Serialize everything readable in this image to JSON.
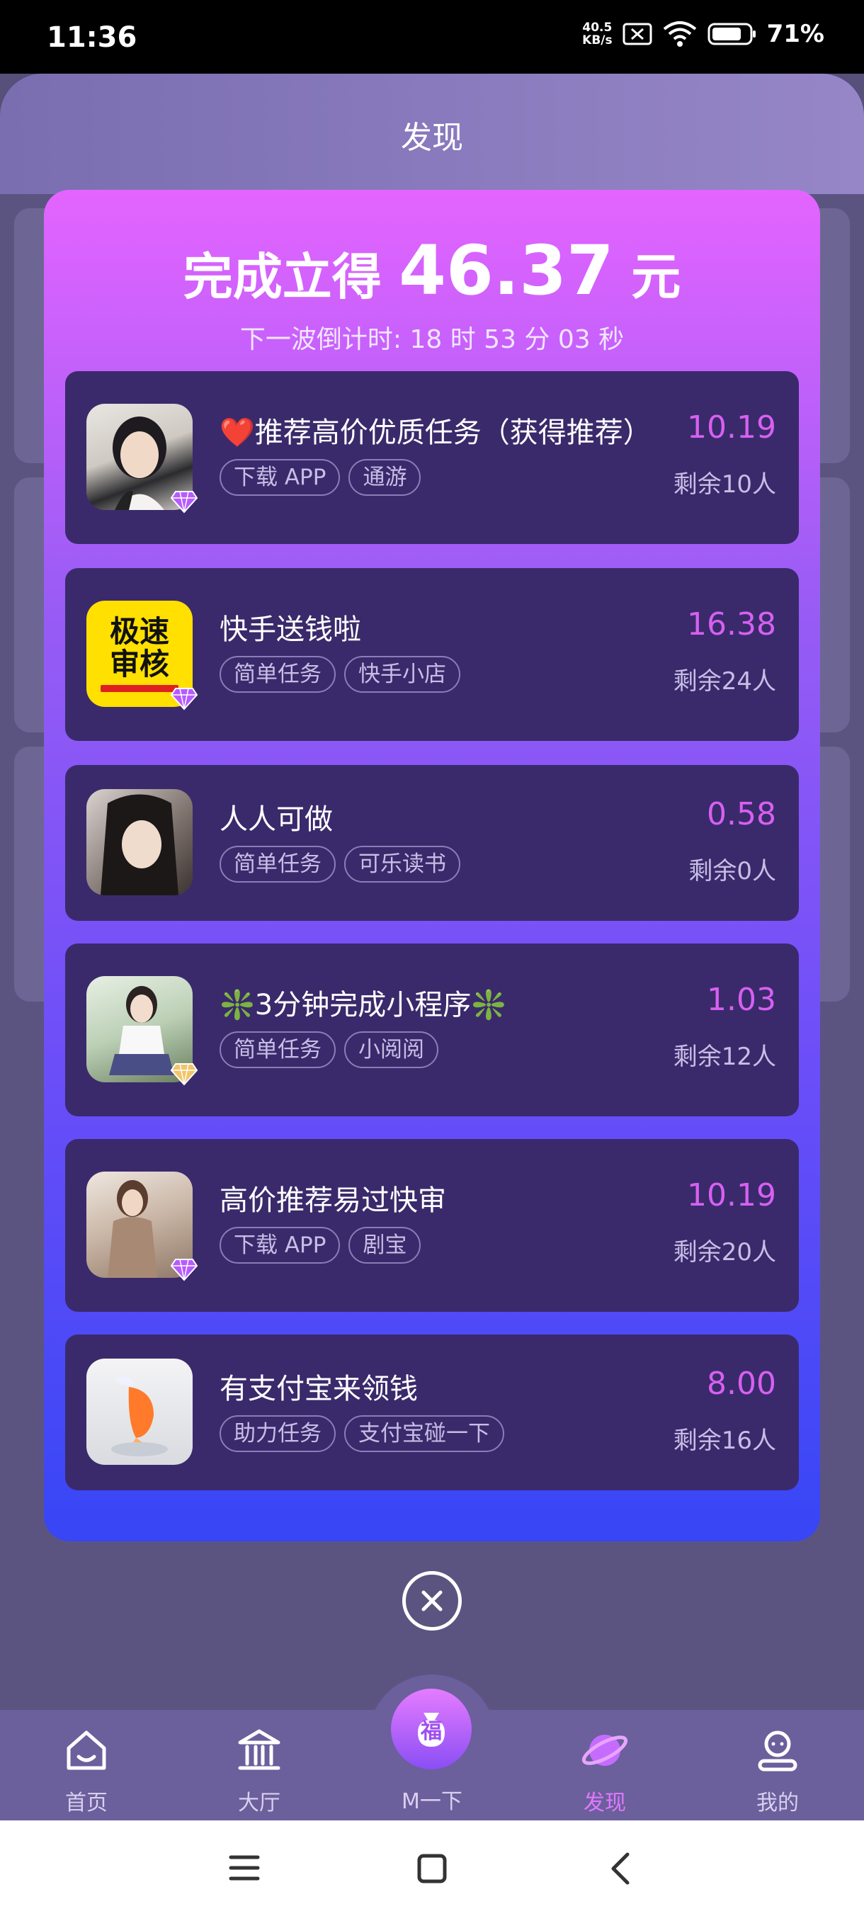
{
  "status_bar": {
    "time": "11:36",
    "net_speed_top": "40.5",
    "net_speed_bottom": "KB/s",
    "battery": "71%"
  },
  "header": {
    "title": "发现"
  },
  "popup": {
    "title_prefix": "完成立得",
    "title_amount": "46.37",
    "title_suffix": "元",
    "countdown": "下一波倒计时: 18 时 53 分 03 秒",
    "tasks": [
      {
        "name": "❤️推荐高价优质任务（获得推荐）",
        "tags": [
          "下载 APP",
          "通游"
        ],
        "price": "10.19",
        "remain": "剩余10人",
        "badge": "diamond-purple",
        "thumb": "girl-short-hair"
      },
      {
        "name": "快手送钱啦",
        "tags": [
          "简单任务",
          "快手小店"
        ],
        "price": "16.38",
        "remain": "剩余24人",
        "badge": "diamond-purple",
        "thumb": "yellow-logo",
        "thumb_text_1": "极速",
        "thumb_text_2": "审核"
      },
      {
        "name": "人人可做",
        "tags": [
          "简单任务",
          "可乐读书"
        ],
        "price": "0.58",
        "remain": "剩余0人",
        "badge": "",
        "thumb": "girl-long-hair"
      },
      {
        "name": "❇️3分钟完成小程序❇️",
        "tags": [
          "简单任务",
          "小阅阅"
        ],
        "price": "1.03",
        "remain": "剩余12人",
        "badge": "diamond-gold",
        "thumb": "girl-uniform"
      },
      {
        "name": "高价推荐易过快审",
        "tags": [
          "下载 APP",
          "剧宝"
        ],
        "price": "10.19",
        "remain": "剩余20人",
        "badge": "diamond-purple",
        "thumb": "woman-sweater"
      },
      {
        "name": "有支付宝来领钱",
        "tags": [
          "助力任务",
          "支付宝碰一下"
        ],
        "price": "8.00",
        "remain": "剩余16人",
        "badge": "",
        "thumb": "koi-fish"
      }
    ]
  },
  "nav": {
    "items": [
      {
        "label": "首页",
        "icon": "home-icon"
      },
      {
        "label": "大厅",
        "icon": "hall-icon"
      },
      {
        "label": "M一下",
        "icon": "fu-bag-icon",
        "center_glyph": "福"
      },
      {
        "label": "发现",
        "icon": "planet-icon",
        "active": true
      },
      {
        "label": "我的",
        "icon": "profile-icon"
      }
    ]
  },
  "colors": {
    "price": "#d760f2",
    "active_tab": "#e078ff",
    "card_bg": "#3a2a6b"
  }
}
